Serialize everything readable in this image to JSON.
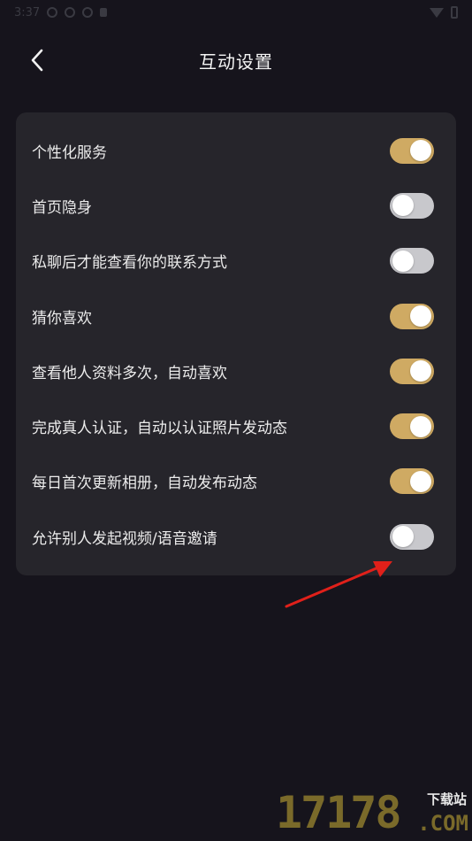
{
  "status_bar": {
    "time": "3:37"
  },
  "header": {
    "title": "互动设置"
  },
  "settings": [
    {
      "label": "个性化服务",
      "enabled": true
    },
    {
      "label": "首页隐身",
      "enabled": false
    },
    {
      "label": "私聊后才能查看你的联系方式",
      "enabled": false
    },
    {
      "label": "猜你喜欢",
      "enabled": true
    },
    {
      "label": "查看他人资料多次，自动喜欢",
      "enabled": true
    },
    {
      "label": "完成真人认证，自动以认证照片发动态",
      "enabled": true
    },
    {
      "label": "每日首次更新相册，自动发布动态",
      "enabled": true
    },
    {
      "label": "允许别人发起视频/语音邀请",
      "enabled": false
    }
  ],
  "watermark": {
    "number": "17178",
    "site": "下载站",
    "domain": ".COM"
  },
  "colors": {
    "background": "#16141c",
    "card": "#26252b",
    "toggle_on": "#cfaa63",
    "toggle_off": "#c8c8cc",
    "annotation_arrow": "#e0201a"
  }
}
